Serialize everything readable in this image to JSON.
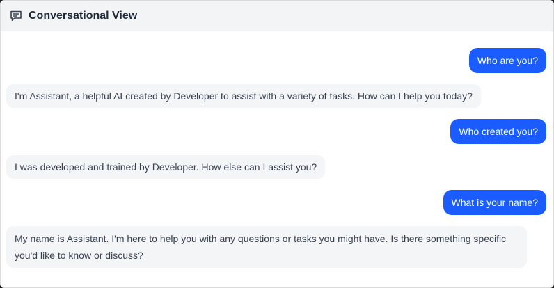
{
  "header": {
    "title": "Conversational View",
    "icon": "chat-bubble-icon"
  },
  "messages": [
    {
      "role": "user",
      "text": "Who are you?"
    },
    {
      "role": "assistant",
      "text": "I'm Assistant, a helpful AI created by Developer to assist with a variety of tasks. How can I help you today?"
    },
    {
      "role": "user",
      "text": "Who created you?"
    },
    {
      "role": "assistant",
      "text": "I was developed and trained by Developer. How else can I assist you?"
    },
    {
      "role": "user",
      "text": "What is your name?"
    },
    {
      "role": "assistant",
      "text": "My name is Assistant. I'm here to help you with any questions or tasks you might have. Is there something specific you'd like to know or discuss?"
    }
  ],
  "colors": {
    "user_bubble": "#1a5cff",
    "assistant_bubble": "#f4f5f7",
    "header_bg": "#f3f4f6"
  }
}
